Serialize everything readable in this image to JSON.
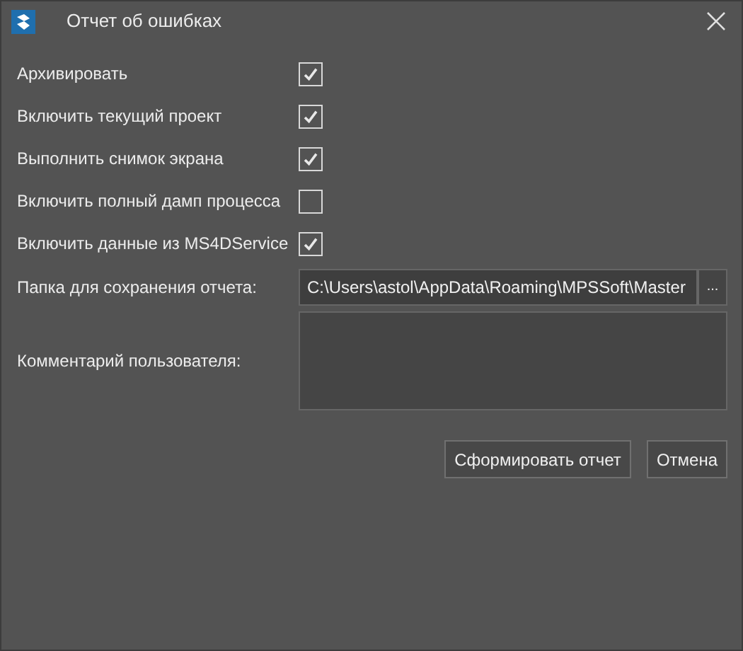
{
  "window": {
    "title": "Отчет об ошибках"
  },
  "options": [
    {
      "label": "Архивировать",
      "checked": true
    },
    {
      "label": "Включить текущий проект",
      "checked": true
    },
    {
      "label": "Выполнить снимок экрана",
      "checked": true
    },
    {
      "label": "Включить полный дамп процесса",
      "checked": false
    },
    {
      "label": "Включить данные из MS4DService",
      "checked": true
    }
  ],
  "folder": {
    "label": "Папка для сохранения отчета:",
    "value": "C:\\Users\\astol\\AppData\\Roaming\\MPSSoft\\Master",
    "browse": "..."
  },
  "comment": {
    "label": "Комментарий пользователя:"
  },
  "buttons": [
    "Сформировать отчет",
    "Отмена"
  ]
}
